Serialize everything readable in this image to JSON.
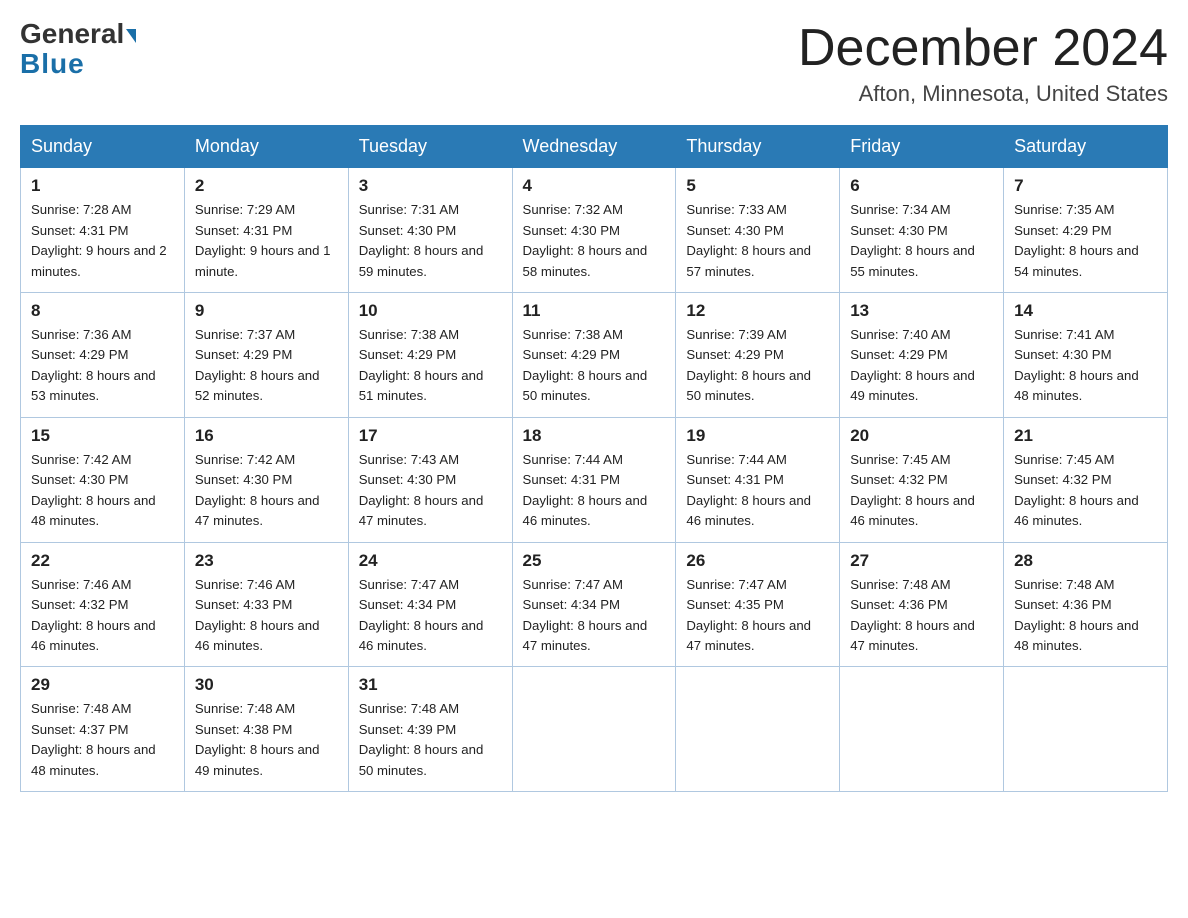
{
  "header": {
    "logo_general": "General",
    "logo_blue": "Blue",
    "month_title": "December 2024",
    "location": "Afton, Minnesota, United States"
  },
  "weekdays": [
    "Sunday",
    "Monday",
    "Tuesday",
    "Wednesday",
    "Thursday",
    "Friday",
    "Saturday"
  ],
  "weeks": [
    [
      {
        "day": "1",
        "sunrise": "7:28 AM",
        "sunset": "4:31 PM",
        "daylight": "9 hours and 2 minutes."
      },
      {
        "day": "2",
        "sunrise": "7:29 AM",
        "sunset": "4:31 PM",
        "daylight": "9 hours and 1 minute."
      },
      {
        "day": "3",
        "sunrise": "7:31 AM",
        "sunset": "4:30 PM",
        "daylight": "8 hours and 59 minutes."
      },
      {
        "day": "4",
        "sunrise": "7:32 AM",
        "sunset": "4:30 PM",
        "daylight": "8 hours and 58 minutes."
      },
      {
        "day": "5",
        "sunrise": "7:33 AM",
        "sunset": "4:30 PM",
        "daylight": "8 hours and 57 minutes."
      },
      {
        "day": "6",
        "sunrise": "7:34 AM",
        "sunset": "4:30 PM",
        "daylight": "8 hours and 55 minutes."
      },
      {
        "day": "7",
        "sunrise": "7:35 AM",
        "sunset": "4:29 PM",
        "daylight": "8 hours and 54 minutes."
      }
    ],
    [
      {
        "day": "8",
        "sunrise": "7:36 AM",
        "sunset": "4:29 PM",
        "daylight": "8 hours and 53 minutes."
      },
      {
        "day": "9",
        "sunrise": "7:37 AM",
        "sunset": "4:29 PM",
        "daylight": "8 hours and 52 minutes."
      },
      {
        "day": "10",
        "sunrise": "7:38 AM",
        "sunset": "4:29 PM",
        "daylight": "8 hours and 51 minutes."
      },
      {
        "day": "11",
        "sunrise": "7:38 AM",
        "sunset": "4:29 PM",
        "daylight": "8 hours and 50 minutes."
      },
      {
        "day": "12",
        "sunrise": "7:39 AM",
        "sunset": "4:29 PM",
        "daylight": "8 hours and 50 minutes."
      },
      {
        "day": "13",
        "sunrise": "7:40 AM",
        "sunset": "4:29 PM",
        "daylight": "8 hours and 49 minutes."
      },
      {
        "day": "14",
        "sunrise": "7:41 AM",
        "sunset": "4:30 PM",
        "daylight": "8 hours and 48 minutes."
      }
    ],
    [
      {
        "day": "15",
        "sunrise": "7:42 AM",
        "sunset": "4:30 PM",
        "daylight": "8 hours and 48 minutes."
      },
      {
        "day": "16",
        "sunrise": "7:42 AM",
        "sunset": "4:30 PM",
        "daylight": "8 hours and 47 minutes."
      },
      {
        "day": "17",
        "sunrise": "7:43 AM",
        "sunset": "4:30 PM",
        "daylight": "8 hours and 47 minutes."
      },
      {
        "day": "18",
        "sunrise": "7:44 AM",
        "sunset": "4:31 PM",
        "daylight": "8 hours and 46 minutes."
      },
      {
        "day": "19",
        "sunrise": "7:44 AM",
        "sunset": "4:31 PM",
        "daylight": "8 hours and 46 minutes."
      },
      {
        "day": "20",
        "sunrise": "7:45 AM",
        "sunset": "4:32 PM",
        "daylight": "8 hours and 46 minutes."
      },
      {
        "day": "21",
        "sunrise": "7:45 AM",
        "sunset": "4:32 PM",
        "daylight": "8 hours and 46 minutes."
      }
    ],
    [
      {
        "day": "22",
        "sunrise": "7:46 AM",
        "sunset": "4:32 PM",
        "daylight": "8 hours and 46 minutes."
      },
      {
        "day": "23",
        "sunrise": "7:46 AM",
        "sunset": "4:33 PM",
        "daylight": "8 hours and 46 minutes."
      },
      {
        "day": "24",
        "sunrise": "7:47 AM",
        "sunset": "4:34 PM",
        "daylight": "8 hours and 46 minutes."
      },
      {
        "day": "25",
        "sunrise": "7:47 AM",
        "sunset": "4:34 PM",
        "daylight": "8 hours and 47 minutes."
      },
      {
        "day": "26",
        "sunrise": "7:47 AM",
        "sunset": "4:35 PM",
        "daylight": "8 hours and 47 minutes."
      },
      {
        "day": "27",
        "sunrise": "7:48 AM",
        "sunset": "4:36 PM",
        "daylight": "8 hours and 47 minutes."
      },
      {
        "day": "28",
        "sunrise": "7:48 AM",
        "sunset": "4:36 PM",
        "daylight": "8 hours and 48 minutes."
      }
    ],
    [
      {
        "day": "29",
        "sunrise": "7:48 AM",
        "sunset": "4:37 PM",
        "daylight": "8 hours and 48 minutes."
      },
      {
        "day": "30",
        "sunrise": "7:48 AM",
        "sunset": "4:38 PM",
        "daylight": "8 hours and 49 minutes."
      },
      {
        "day": "31",
        "sunrise": "7:48 AM",
        "sunset": "4:39 PM",
        "daylight": "8 hours and 50 minutes."
      },
      null,
      null,
      null,
      null
    ]
  ]
}
